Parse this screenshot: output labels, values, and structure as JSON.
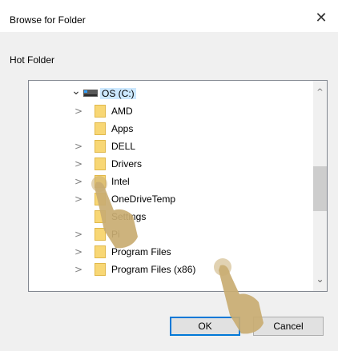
{
  "dialog": {
    "title": "Browse for Folder",
    "close_glyph": "✕",
    "instruction": "Hot Folder"
  },
  "tree": {
    "root": {
      "label": "OS (C:)",
      "expander": "⌄",
      "icon": "drive-icon"
    },
    "items": [
      {
        "label": "AMD",
        "expander": ">"
      },
      {
        "label": "Apps",
        "expander": ""
      },
      {
        "label": "DELL",
        "expander": ">"
      },
      {
        "label": "Drivers",
        "expander": ">"
      },
      {
        "label": "Intel",
        "expander": ">"
      },
      {
        "label": "OneDriveTemp",
        "expander": ">"
      },
      {
        "label": "Settings",
        "expander": ""
      },
      {
        "label": "Pi",
        "expander": ">"
      },
      {
        "label": "Program Files",
        "expander": ">"
      },
      {
        "label": "Program Files (x86)",
        "expander": ">"
      }
    ],
    "scroll_up": "^",
    "scroll_down": "⌄"
  },
  "buttons": {
    "ok": "OK",
    "cancel": "Cancel"
  },
  "colors": {
    "selection": "#cce8ff",
    "folder": "#f8d775",
    "focus": "#0078d7",
    "hand": "#c9ad72"
  }
}
